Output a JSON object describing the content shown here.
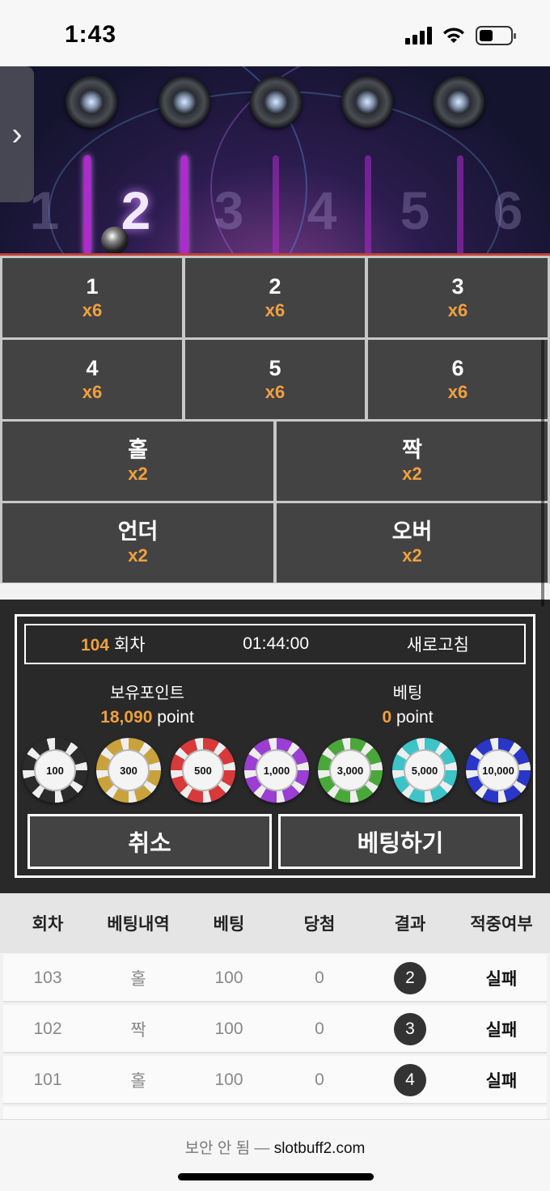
{
  "status_bar": {
    "time": "1:43"
  },
  "banner": {
    "slot_numbers": [
      "1",
      "2",
      "3",
      "4",
      "5",
      "6"
    ],
    "active_slot": "2",
    "side_tab_glyph": "›"
  },
  "bet_options": [
    {
      "label": "1",
      "multiplier": "x6"
    },
    {
      "label": "2",
      "multiplier": "x6"
    },
    {
      "label": "3",
      "multiplier": "x6"
    },
    {
      "label": "4",
      "multiplier": "x6"
    },
    {
      "label": "5",
      "multiplier": "x6"
    },
    {
      "label": "6",
      "multiplier": "x6"
    },
    {
      "label": "홀",
      "multiplier": "x2"
    },
    {
      "label": "짝",
      "multiplier": "x2"
    },
    {
      "label": "언더",
      "multiplier": "x2"
    },
    {
      "label": "오버",
      "multiplier": "x2"
    }
  ],
  "round": {
    "number": "104",
    "suffix": " 회차",
    "timer": "01:44:00",
    "refresh_label": "새로고침"
  },
  "points": {
    "held_label": "보유포인트",
    "held_value": "18,090",
    "held_unit": " point",
    "bet_label": "베팅",
    "bet_value": "0",
    "bet_unit": " point"
  },
  "chips": [
    {
      "value": "100",
      "color": "#2b2b2b"
    },
    {
      "value": "300",
      "color": "#c9a23c"
    },
    {
      "value": "500",
      "color": "#d8393a"
    },
    {
      "value": "1,000",
      "color": "#9b3ed3"
    },
    {
      "value": "3,000",
      "color": "#4aa83a"
    },
    {
      "value": "5,000",
      "color": "#3cc4c8"
    },
    {
      "value": "10,000",
      "color": "#2a36c8"
    }
  ],
  "buttons": {
    "cancel": "취소",
    "place_bet": "베팅하기"
  },
  "history": {
    "headers": [
      "회차",
      "베팅내역",
      "베팅",
      "당첨",
      "결과",
      "적중여부"
    ],
    "rows": [
      {
        "round": "103",
        "pick": "홀",
        "bet": "100",
        "win": "0",
        "result": "2",
        "status": "실패"
      },
      {
        "round": "102",
        "pick": "짝",
        "bet": "100",
        "win": "0",
        "result": "3",
        "status": "실패"
      },
      {
        "round": "101",
        "pick": "홀",
        "bet": "100",
        "win": "0",
        "result": "4",
        "status": "실패"
      }
    ]
  },
  "browser": {
    "insecure_label": "보안 안 됨 — ",
    "domain": "slotbuff2.com"
  }
}
